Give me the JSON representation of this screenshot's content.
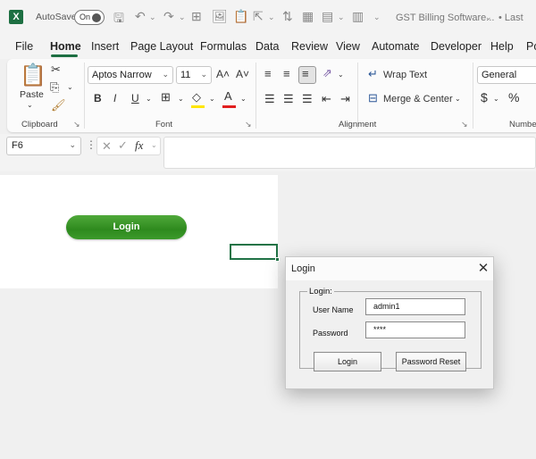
{
  "titlebar": {
    "app_icon": "X",
    "autosave_label": "AutoSave",
    "autosave_state": "On",
    "document_title": "GST Billing Software...",
    "extra_text": "• Last"
  },
  "menu": {
    "tabs": [
      "File",
      "Home",
      "Insert",
      "Page Layout",
      "Formulas",
      "Data",
      "Review",
      "View",
      "Automate",
      "Developer",
      "Help",
      "Po"
    ],
    "active_tab": "Home"
  },
  "ribbon": {
    "clipboard": {
      "paste_label": "Paste",
      "group_label": "Clipboard"
    },
    "font": {
      "font_name": "Aptos Narrow",
      "font_size": "11",
      "group_label": "Font",
      "bold": "B",
      "italic": "I",
      "underline": "U"
    },
    "alignment": {
      "wrap_text": "Wrap Text",
      "merge_center": "Merge & Center",
      "group_label": "Alignment"
    },
    "number": {
      "format": "General",
      "currency": "$",
      "percent": "%",
      "group_label": "Numbe"
    }
  },
  "formula_bar": {
    "name_box": "F6",
    "fx": "fx",
    "value": ""
  },
  "sheet": {
    "login_button_label": "Login"
  },
  "dialog": {
    "title": "Login",
    "frame_label": "Login:",
    "username_label": "User Name",
    "username_value": "admin1",
    "password_label": "Password",
    "password_value": "****",
    "login_button": "Login",
    "reset_button": "Password Reset"
  },
  "colors": {
    "excel_green": "#217346",
    "button_green": "#2e8a1e"
  }
}
